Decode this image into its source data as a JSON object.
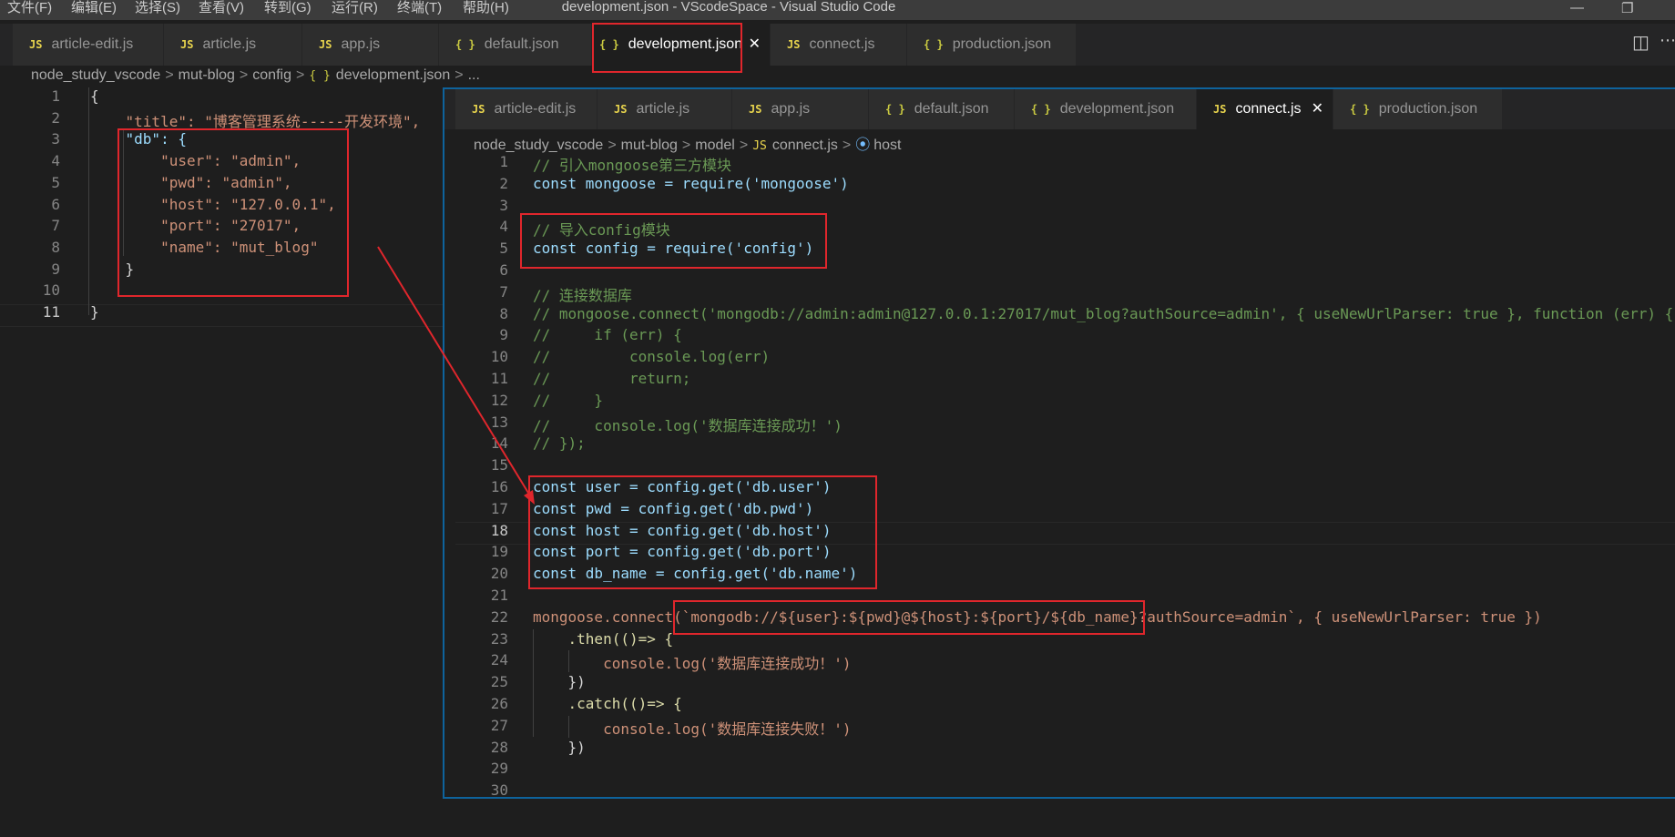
{
  "menubar": {
    "items": [
      "文件(F)",
      "编辑(E)",
      "选择(S)",
      "查看(V)",
      "转到(G)",
      "运行(R)",
      "终端(T)",
      "帮助(H)"
    ],
    "title": "development.json - VScodeSpace - Visual Studio Code"
  },
  "icons": {
    "js": "JS",
    "json": "{ }",
    "close": "✕",
    "split": "◫",
    "more": "⋯",
    "restore": "❐",
    "minimize": "—",
    "symbol": "⦿"
  },
  "back_editor": {
    "tabs": [
      "article-edit.js",
      "article.js",
      "app.js",
      "default.json",
      "development.json",
      "connect.js",
      "production.json"
    ],
    "breadcrumb": [
      "node_study_vscode",
      "mut-blog",
      "config",
      "development.json",
      "..."
    ],
    "lines": [
      "{",
      "    \"title\": \"博客管理系统-----开发环境\",",
      "    \"db\": {",
      "        \"user\": \"admin\",",
      "        \"pwd\": \"admin\",",
      "        \"host\": \"127.0.0.1\",",
      "        \"port\": \"27017\",",
      "        \"name\": \"mut_blog\"",
      "    }",
      "",
      "}"
    ]
  },
  "front_editor": {
    "tabs": [
      "article-edit.js",
      "article.js",
      "app.js",
      "default.json",
      "development.json",
      "connect.js",
      "production.json"
    ],
    "breadcrumb": [
      "node_study_vscode",
      "mut-blog",
      "model",
      "connect.js",
      "host"
    ],
    "lines": [
      "// 引入mongoose第三方模块",
      "const mongoose = require('mongoose')",
      "",
      "// 导入config模块",
      "const config = require('config')",
      "",
      "// 连接数据库",
      "// mongoose.connect('mongodb://admin:admin@127.0.0.1:27017/mut_blog?authSource=admin', { useNewUrlParser: true }, function (err) {",
      "//     if (err) {",
      "//         console.log(err)",
      "//         return;",
      "//     }",
      "//     console.log('数据库连接成功！')",
      "// });",
      "",
      "const user = config.get('db.user')",
      "const pwd = config.get('db.pwd')",
      "const host = config.get('db.host')",
      "const port = config.get('db.port')",
      "const db_name = config.get('db.name')",
      "",
      "mongoose.connect(`mongodb://${user}:${pwd}@${host}:${port}/${db_name}?authSource=admin`, { useNewUrlParser: true })",
      "    .then(()=> {",
      "        console.log('数据库连接成功！')",
      "    })",
      "    .catch(()=> {",
      "        console.log('数据库连接失败！')",
      "    })",
      "",
      ""
    ]
  },
  "colors": {
    "annotation": "#e0262c",
    "focus_border": "#0e639c",
    "keyword": "#569cd6",
    "string": "#ce9178",
    "comment": "#6a9955"
  }
}
